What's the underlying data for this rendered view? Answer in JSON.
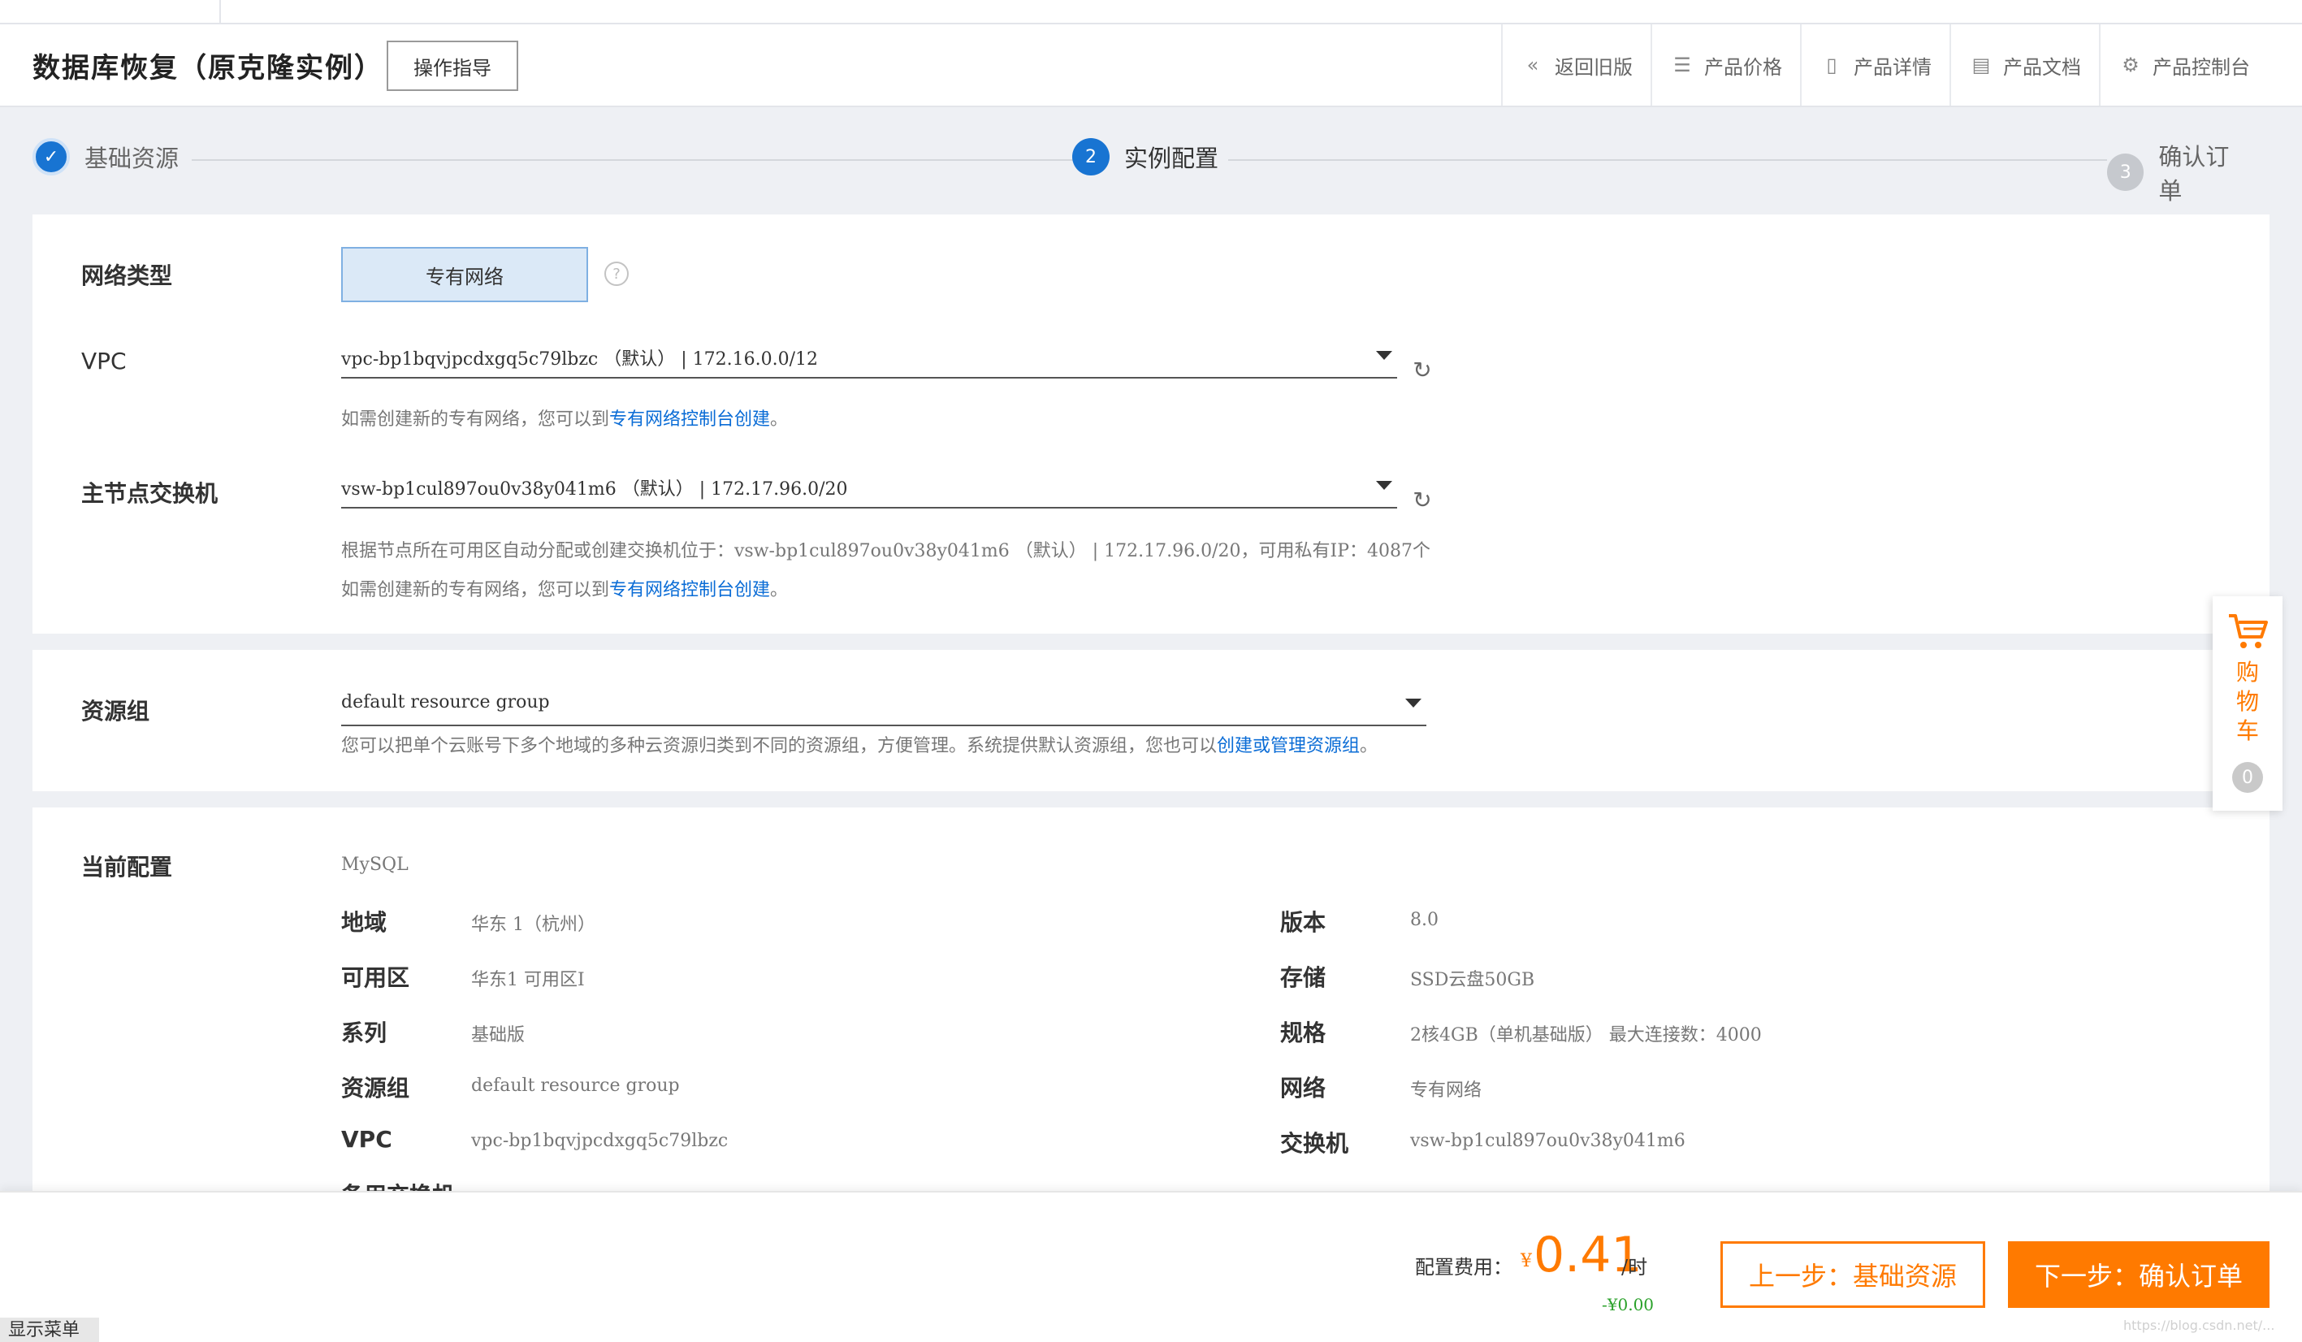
{
  "header": {
    "title": "数据库恢复（原克隆实例）",
    "guide_button": "操作指导",
    "links": [
      {
        "label": "返回旧版",
        "icon": "double-chevron-left-icon"
      },
      {
        "label": "产品价格",
        "icon": "price-list-icon"
      },
      {
        "label": "产品详情",
        "icon": "detail-doc-icon"
      },
      {
        "label": "产品文档",
        "icon": "document-icon"
      },
      {
        "label": "产品控制台",
        "icon": "gear-icon"
      }
    ]
  },
  "steps": [
    {
      "label": "基础资源",
      "number": "✓",
      "state": "done"
    },
    {
      "label": "实例配置",
      "number": "2",
      "state": "active"
    },
    {
      "label": "确认订单",
      "number": "3",
      "state": "todo"
    }
  ],
  "network": {
    "type_label": "网络类型",
    "type_value": "专有网络",
    "vpc_label": "VPC",
    "vpc_value": "vpc-bp1bqvjpcdxgq5c79lbzc （默认） | 172.16.0.0/12",
    "vpc_hint_prefix": "如需创建新的专有网络，您可以到",
    "vpc_hint_link": "专有网络控制台创建",
    "vpc_hint_suffix": "。",
    "switch_label": "主节点交换机",
    "switch_value": "vsw-bp1cul897ou0v38y041m6 （默认） | 172.17.96.0/20",
    "switch_hint1": "根据节点所在可用区自动分配或创建交换机位于：vsw-bp1cul897ou0v38y041m6 （默认） | 172.17.96.0/20，可用私有IP：4087个",
    "switch_hint2_prefix": "如需创建新的专有网络，您可以到",
    "switch_hint2_link": "专有网络控制台创建",
    "switch_hint2_suffix": "。"
  },
  "resource_group": {
    "label": "资源组",
    "value": "default resource group",
    "hint_prefix": "您可以把单个云账号下多个地域的多种云资源归类到不同的资源组，方便管理。系统提供默认资源组，您也可以",
    "hint_link": "创建或管理资源组",
    "hint_suffix": "。"
  },
  "current_config": {
    "label": "当前配置",
    "engine": "MySQL",
    "left": [
      {
        "key": "地域",
        "value": "华东 1（杭州）"
      },
      {
        "key": "可用区",
        "value": "华东1 可用区I"
      },
      {
        "key": "系列",
        "value": "基础版"
      },
      {
        "key": "资源组",
        "value": "default resource group"
      },
      {
        "key": "VPC",
        "value": "vpc-bp1bqvjpcdxgq5c79lbzc"
      }
    ],
    "right": [
      {
        "key": "版本",
        "value": "8.0"
      },
      {
        "key": "存储",
        "value": "SSD云盘50GB"
      },
      {
        "key": "规格",
        "value": "2核4GB（单机基础版） 最大连接数：4000"
      },
      {
        "key": "网络",
        "value": "专有网络"
      },
      {
        "key": "交换机",
        "value": "vsw-bp1cul897ou0v38y041m6"
      }
    ],
    "partial_row": "备用交换机"
  },
  "cart": {
    "label_chars": [
      "购",
      "物",
      "车"
    ],
    "count": "0"
  },
  "footer": {
    "fee_label": "配置费用：",
    "currency": "¥",
    "amount": "0.41",
    "unit": "/时",
    "discount": "-¥0.00",
    "prev_button": "上一步：基础资源",
    "next_button": "下一步：确认订单",
    "show_menu": "显示菜单",
    "watermark": "https://blog.csdn.net/..."
  },
  "colors": {
    "accent": "#ff7a00",
    "primary": "#1874d2",
    "link": "#0a6cd6"
  }
}
